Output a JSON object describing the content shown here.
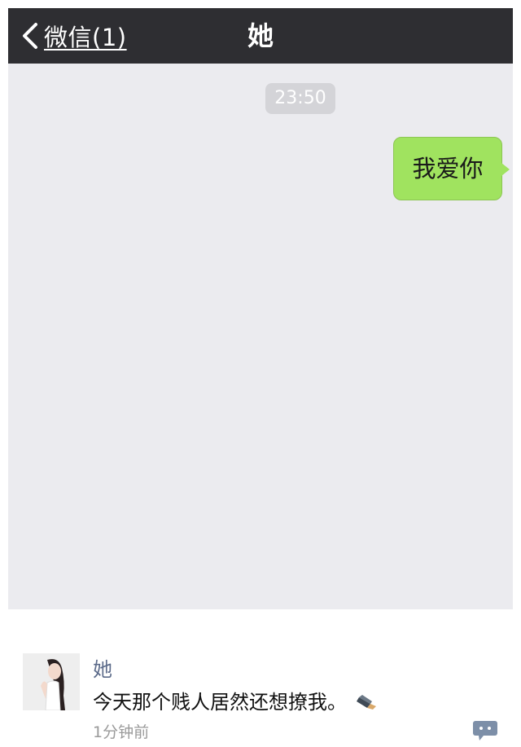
{
  "header": {
    "back_label": "微信(1)",
    "title": "她"
  },
  "chat": {
    "timestamp": "23:50",
    "messages": [
      {
        "sender": "me",
        "text": "我爱你"
      }
    ]
  },
  "notification": {
    "name": "她",
    "message": "今天那个贱人居然还想撩我。",
    "time": "1分钟前"
  },
  "icons": {
    "back": "chevron-left-icon",
    "emoji": "pen-emoji-icon",
    "comment": "comment-icon"
  },
  "colors": {
    "navbar": "#2e2e32",
    "chat_background": "#ebebef",
    "bubble": "#a0e35f",
    "name": "#5c6b8a"
  }
}
